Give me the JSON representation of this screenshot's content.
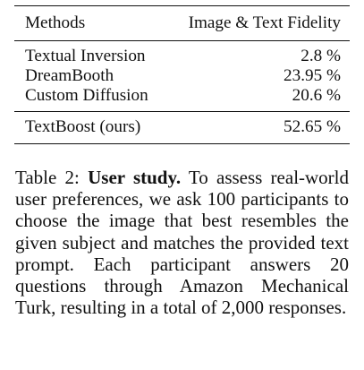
{
  "table": {
    "headers": {
      "method": "Methods",
      "score": "Image & Text Fidelity"
    },
    "rows": [
      {
        "method": "Textual Inversion",
        "score": "2.8 %"
      },
      {
        "method": "DreamBooth",
        "score": "23.95 %"
      },
      {
        "method": "Custom Diffusion",
        "score": "20.6 %"
      }
    ],
    "ours": {
      "method": "TextBoost (ours)",
      "score": "52.65 %"
    }
  },
  "caption": {
    "label": "Table 2:",
    "title": "User study.",
    "body": "To assess real-world user preferences, we ask 100 participants to choose the image that best resembles the given subject and matches the provided text prompt. Each participant answers 20 questions through Amazon Mechanical Turk, resulting in a total of 2,000 responses."
  }
}
